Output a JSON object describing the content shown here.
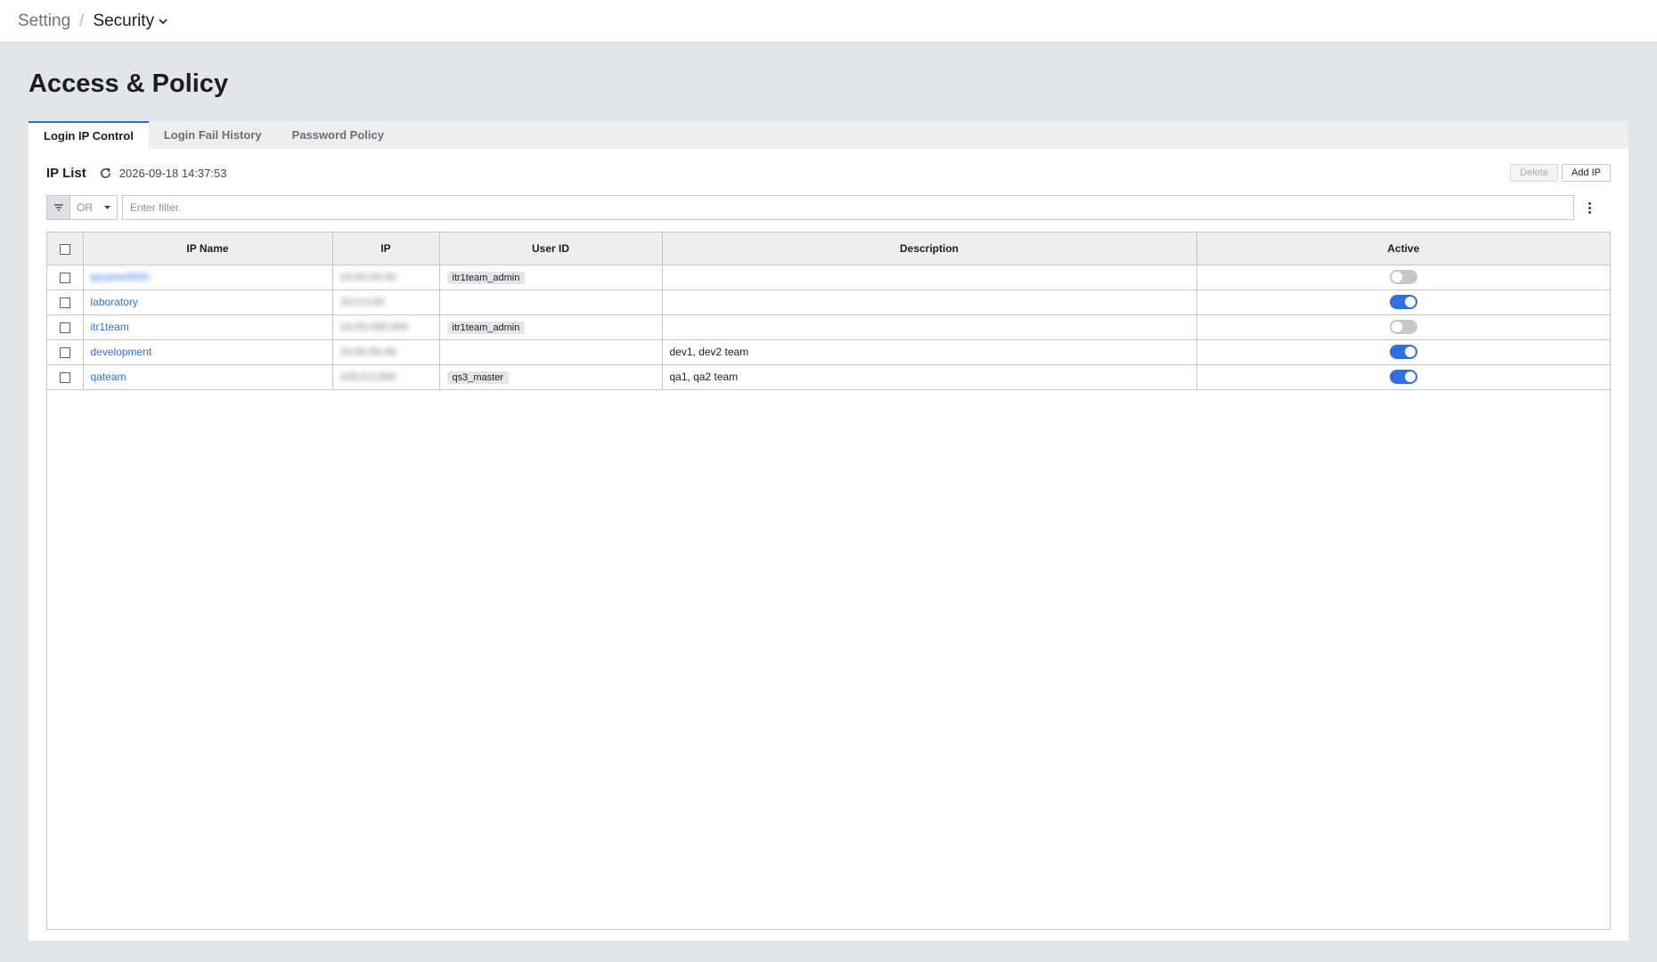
{
  "breadcrumb": {
    "root": "Setting",
    "separator": "/",
    "current": "Security"
  },
  "page": {
    "title": "Access & Policy"
  },
  "tabs": [
    {
      "label": "Login IP Control",
      "active": true
    },
    {
      "label": "Login Fail History",
      "active": false
    },
    {
      "label": "Password Policy",
      "active": false
    }
  ],
  "ip_list": {
    "title": "IP List",
    "timestamp": "2026-09-18 14:37:53",
    "delete_label": "Delete",
    "add_label": "Add IP"
  },
  "filter": {
    "operator": "OR",
    "placeholder": "Enter filter.",
    "value": ""
  },
  "table": {
    "columns": [
      "IP Name",
      "IP",
      "User ID",
      "Description",
      "Active"
    ],
    "rows": [
      {
        "name": "ipname0000",
        "name_blurred": true,
        "ip": "10.00.00.00",
        "user_id": "itr1team_admin",
        "description": "",
        "active": false
      },
      {
        "name": "laboratory",
        "name_blurred": false,
        "ip": "10.0.0.00",
        "user_id": "",
        "description": "",
        "active": true
      },
      {
        "name": "itr1team",
        "name_blurred": false,
        "ip": "10.00.000.000",
        "user_id": "itr1team_admin",
        "description": "",
        "active": false
      },
      {
        "name": "development",
        "name_blurred": false,
        "ip": "10.00.00.00",
        "user_id": "",
        "description": "dev1, dev2 team",
        "active": true
      },
      {
        "name": "qateam",
        "name_blurred": false,
        "ip": "100.0.0.000",
        "user_id": "qs3_master",
        "description": "qa1, qa2 team",
        "active": true
      }
    ]
  },
  "colors": {
    "accent": "#2f6fe4",
    "background": "#e3e6e9",
    "toggle_off": "#c4c7cb"
  }
}
